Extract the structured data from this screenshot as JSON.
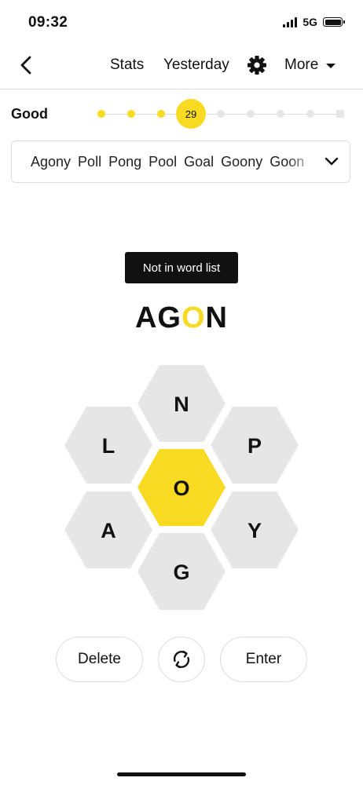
{
  "status_bar": {
    "time": "09:32",
    "network": "5G"
  },
  "nav": {
    "stats_label": "Stats",
    "yesterday_label": "Yesterday",
    "more_label": "More",
    "back_icon": "chevron-left-icon",
    "settings_icon": "gear-icon"
  },
  "progress": {
    "rank": "Good",
    "score": "29",
    "levels_completed": 3,
    "levels_total": 9
  },
  "found_words": {
    "words": [
      "Agony",
      "Poll",
      "Pong",
      "Pool",
      "Goal",
      "Goony",
      "Goon"
    ],
    "expand_icon": "chevron-down-icon"
  },
  "message": {
    "text": "Not in word list"
  },
  "current_word": {
    "before": "AG",
    "center": "O",
    "after": "N"
  },
  "hive": {
    "center": "O",
    "top": "N",
    "upper_left": "L",
    "upper_right": "P",
    "lower_left": "A",
    "lower_right": "Y",
    "bottom": "G"
  },
  "controls": {
    "delete_label": "Delete",
    "enter_label": "Enter",
    "shuffle_icon": "shuffle-icon"
  },
  "colors": {
    "accent": "#f7da21",
    "cell": "#e6e6e6",
    "text": "#111111",
    "border": "#dcdcdc"
  }
}
